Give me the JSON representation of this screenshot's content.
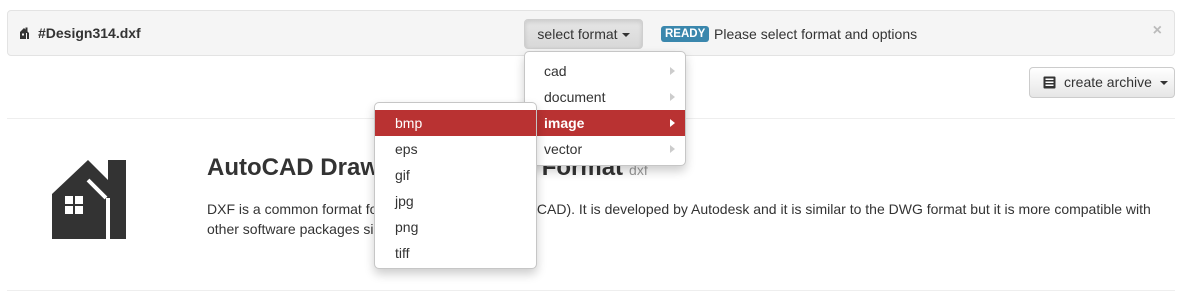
{
  "file": {
    "name": "#Design314.dxf",
    "icon": "file-house-icon"
  },
  "toolbar": {
    "select_label": "select format",
    "status_badge": "READY",
    "status_message": "Please select format and options",
    "close_glyph": "×",
    "archive_label": "create archive"
  },
  "format_menu": {
    "items": [
      {
        "label": "cad",
        "has_submenu": true
      },
      {
        "label": "document",
        "has_submenu": true
      },
      {
        "label": "image",
        "has_submenu": true,
        "active": true
      },
      {
        "label": "vector",
        "has_submenu": true
      }
    ]
  },
  "image_submenu": {
    "items": [
      {
        "label": "bmp",
        "active": true
      },
      {
        "label": "eps"
      },
      {
        "label": "gif"
      },
      {
        "label": "jpg"
      },
      {
        "label": "png"
      },
      {
        "label": "tiff"
      }
    ]
  },
  "description": {
    "title": "AutoCAD Drawing Exchange Format",
    "ext": "dxf",
    "text": "DXF is a common format for computer-aided design (CAD). It is developed by Autodesk and it is similar to the DWG format but it is more compatible with other software packages since it is ASCII-based."
  },
  "colors": {
    "accent": "#b93232",
    "badge": "#3a87ad",
    "icon": "#333333"
  }
}
